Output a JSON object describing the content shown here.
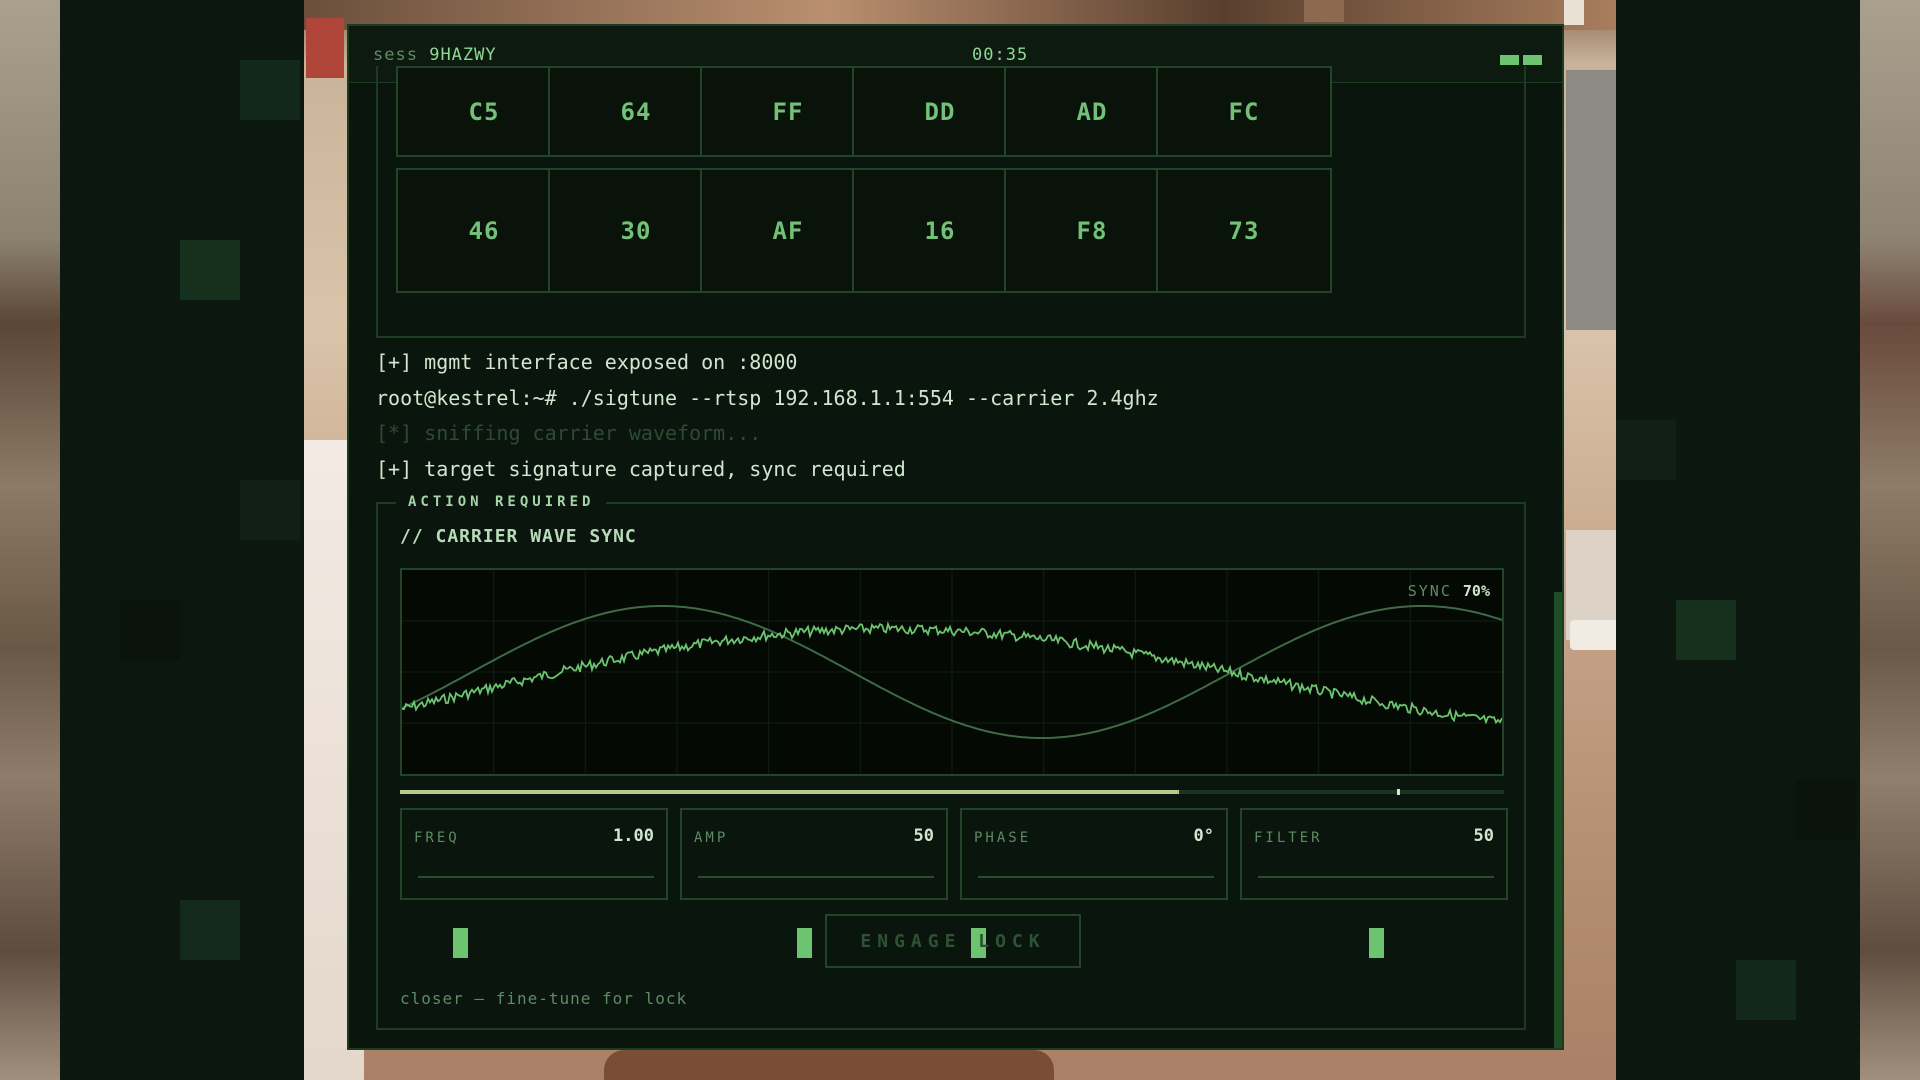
{
  "session": {
    "prefix": "sess",
    "id": "9HAZWY"
  },
  "timer": "00:35",
  "hex_grid": {
    "rows": [
      [
        "C5",
        "64",
        "FF",
        "DD",
        "AD",
        "FC"
      ],
      [
        "46",
        "30",
        "AF",
        "16",
        "F8",
        "73"
      ]
    ]
  },
  "log": [
    {
      "text": "[+] mgmt interface exposed on :8000",
      "style": "normal"
    },
    {
      "text": "root@kestrel:~# ./sigtune --rtsp 192.168.1.1:554 --carrier 2.4ghz",
      "style": "prompt"
    },
    {
      "text": "[*] sniffing carrier waveform...",
      "style": "dim"
    },
    {
      "text": "[+] target signature captured, sync required",
      "style": "normal"
    }
  ],
  "action": {
    "label": "ACTION REQUIRED",
    "title": "// CARRIER WAVE SYNC",
    "sync_label": "SYNC",
    "sync_value": "70%",
    "progress_fraction": 0.706,
    "progress_marker_fraction": 0.903,
    "controls": [
      {
        "name": "freq",
        "label": "FREQ",
        "value": "1.00",
        "level": 0.18
      },
      {
        "name": "amp",
        "label": "AMP",
        "value": "50",
        "level": 0.45
      },
      {
        "name": "phase",
        "label": "PHASE",
        "value": "0°",
        "level": 0.0
      },
      {
        "name": "filter",
        "label": "FILTER",
        "value": "50",
        "level": 0.5
      }
    ],
    "engage_label": "ENGAGE LOCK",
    "hint": "closer — fine-tune for lock"
  },
  "colors": {
    "accent": "#6cc470",
    "background": "#0a150d",
    "border": "#1d3a22"
  }
}
